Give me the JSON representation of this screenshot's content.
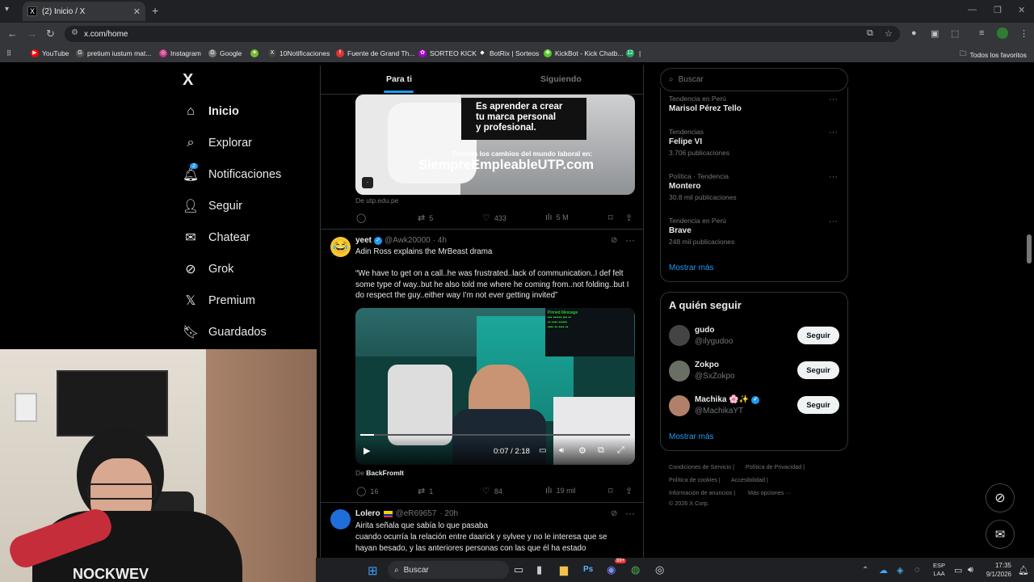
{
  "browser": {
    "tab_title": "(2) Inicio / X",
    "tab_favicon": "x-logo-icon",
    "url": "x.com/home",
    "bookmarks": [
      "YouTube",
      "pretium iustum mat...",
      "Instagram",
      "Google",
      "10Notificaciones",
      "Fuente de Grand Th...",
      "SORTEO KICK",
      "BotRix | Sorteos",
      "KickBot - Kick Chatb..."
    ],
    "bookmark_badge": "12",
    "all_bookmarks": "Todos los favoritos"
  },
  "nav": {
    "logo": "X",
    "items": [
      {
        "label": "Inicio",
        "icon": "home-icon",
        "active": true
      },
      {
        "label": "Explorar",
        "icon": "search-icon"
      },
      {
        "label": "Notificaciones",
        "icon": "bell-icon",
        "badge": "2"
      },
      {
        "label": "Seguir",
        "icon": "person-add-icon"
      },
      {
        "label": "Chatear",
        "icon": "envelope-icon"
      },
      {
        "label": "Grok",
        "icon": "grok-icon"
      },
      {
        "label": "Premium",
        "icon": "x-icon"
      },
      {
        "label": "Guardados",
        "icon": "bookmark-icon"
      }
    ]
  },
  "timeline": {
    "tabs": [
      "Para ti",
      "Siguiendo"
    ],
    "ad": {
      "overlay_line1": "Es aprender a crear",
      "overlay_line2": "tu marca personal",
      "overlay_line3": "y profesional.",
      "sub": "Domina los cambios del mundo laboral en:",
      "brand": "SiempreEmpleableUTP.com",
      "source": "De utp.edu.pe",
      "reposts": "5",
      "likes": "433",
      "views": "5 M"
    },
    "tweet1": {
      "name": "yeet",
      "handle": "@Awk20000",
      "time": "· 4h",
      "line1": "Adin Ross explains the MrBeast drama",
      "quote": "“We have to get on a call..he was frustrated..lack of communication..I def felt some type of way..but he also told me where he coming from..not folding..but I do respect the guy..either way I’m not ever getting invited”",
      "video_time": "0:07 / 2:18",
      "from_label": "De ",
      "from_name": "BackFromIt",
      "replies": "16",
      "reposts": "1",
      "likes": "84",
      "views": "19 mil"
    },
    "tweet2": {
      "name": "Lolero",
      "handle": "@eR69657",
      "time": "· 20h",
      "line1": "Airita señala que sabía lo que pasaba",
      "line2": "cuando ocurría la relación entre daarick y sylvee  y no le interesa que se hayan besado, y las anteriores personas con las que él ha  estado"
    }
  },
  "sidebar": {
    "search_placeholder": "Buscar",
    "trends": [
      {
        "context": "Tendencia en Perú",
        "name": "Marisol Pérez Tello",
        "count": ""
      },
      {
        "context": "Tendencias",
        "name": "Felipe VI",
        "count": "3.706 publicaciones"
      },
      {
        "context": "Política · Tendencia",
        "name": "Montero",
        "count": "30,8 mil publicaciones"
      },
      {
        "context": "Tendencia en Perú",
        "name": "Brave",
        "count": "248 mil publicaciones"
      }
    ],
    "show_more": "Mostrar más",
    "who_to_follow": "A quién seguir",
    "follow": [
      {
        "name": "gudo",
        "handle": "@ilygudoo"
      },
      {
        "name": "Zokpo",
        "handle": "@SxZokpo"
      },
      {
        "name": "Machika 🌸✨",
        "handle": "@MachikaYT",
        "verified": true
      }
    ],
    "follow_button": "Seguir",
    "show_more2": "Mostrar más",
    "footer": [
      "Condiciones de Servicio",
      "Política de Privacidad",
      "Política de cookies",
      "Accesibilidad",
      "Información de anuncios",
      "Más opciones ···",
      "© 2026 X Corp."
    ]
  },
  "taskbar": {
    "search": "Buscar",
    "lang1": "ESP",
    "lang2": "LAA",
    "time": "17:35",
    "date": "9/1/2026",
    "badge": "99+"
  }
}
